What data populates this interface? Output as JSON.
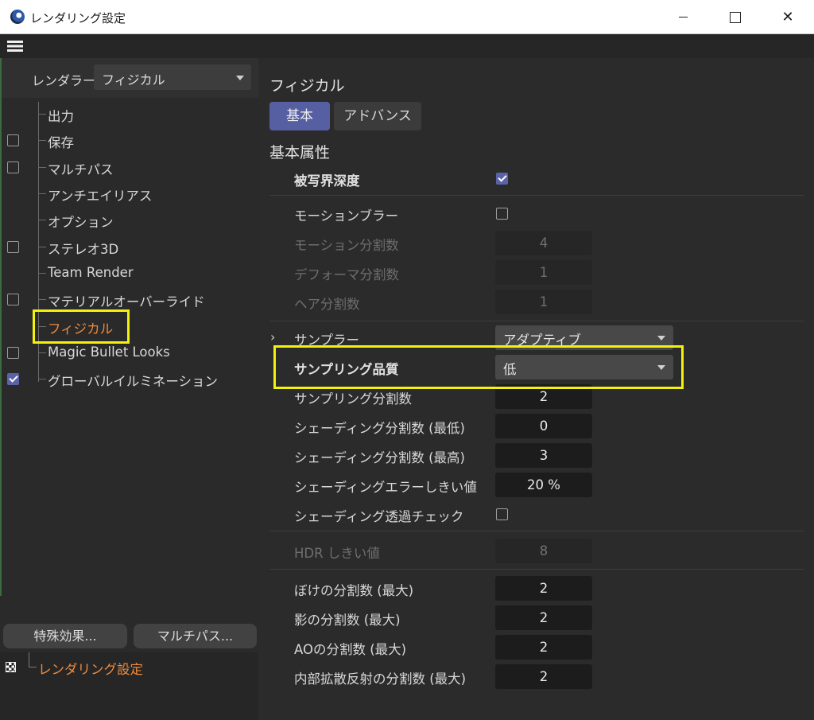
{
  "window": {
    "title": "レンダリング設定",
    "close_glyph": "✕"
  },
  "left": {
    "renderer_label": "レンダラー",
    "renderer_value": "フィジカル",
    "tree": [
      {
        "label": "出力",
        "checkbox": null
      },
      {
        "label": "保存",
        "checkbox": false
      },
      {
        "label": "マルチパス",
        "checkbox": false
      },
      {
        "label": "アンチエイリアス",
        "checkbox": null
      },
      {
        "label": "オプション",
        "checkbox": null
      },
      {
        "label": "ステレオ3D",
        "checkbox": false
      },
      {
        "label": "Team Render",
        "checkbox": null
      },
      {
        "label": "マテリアルオーバーライド",
        "checkbox": false
      },
      {
        "label": "フィジカル",
        "checkbox": null,
        "active": true
      },
      {
        "label": "Magic Bullet Looks",
        "checkbox": false
      },
      {
        "label": "グローバルイルミネーション",
        "checkbox": true
      }
    ],
    "buttons": {
      "effects": "特殊効果...",
      "multipass": "マルチパス..."
    },
    "settings_root": "レンダリング設定"
  },
  "right": {
    "panel_title": "フィジカル",
    "tabs": {
      "basic": "基本",
      "advanced": "アドバンス"
    },
    "section_title": "基本属性",
    "rows": {
      "depth_of_field": {
        "label": "被写界深度",
        "checked": true
      },
      "motion_blur": {
        "label": "モーションブラー",
        "checked": false
      },
      "motion_subdiv": {
        "label": "モーション分割数",
        "value": "4"
      },
      "deformation_subdiv": {
        "label": "デフォーマ分割数",
        "value": "1"
      },
      "hair_subdiv": {
        "label": "ヘア分割数",
        "value": "1"
      },
      "sampler": {
        "label": "サンプラー",
        "value": "アダプティブ"
      },
      "sampling_quality": {
        "label": "サンプリング品質",
        "value": "低"
      },
      "sampling_subdiv": {
        "label": "サンプリング分割数",
        "value": "2"
      },
      "shading_subdiv_min": {
        "label": "シェーディング分割数 (最低)",
        "value": "0"
      },
      "shading_subdiv_max": {
        "label": "シェーディング分割数 (最高)",
        "value": "3"
      },
      "shading_error_threshold": {
        "label": "シェーディングエラーしきい値",
        "value": "20 %"
      },
      "shading_transparency_check": {
        "label": "シェーディング透過チェック",
        "checked": false
      },
      "hdr_threshold": {
        "label": "HDR しきい値",
        "value": "8"
      },
      "blur_subdiv_max": {
        "label": "ぼけの分割数 (最大)",
        "value": "2"
      },
      "shadow_subdiv_max": {
        "label": "影の分割数 (最大)",
        "value": "2"
      },
      "ao_subdiv_max": {
        "label": "AOの分割数 (最大)",
        "value": "2"
      },
      "sss_subdiv_max": {
        "label": "内部拡散反射の分割数 (最大)",
        "value": "2"
      }
    }
  },
  "colors": {
    "accent": "#575fa3",
    "highlight": "#f2f20a",
    "active_text": "#f08a3c"
  }
}
